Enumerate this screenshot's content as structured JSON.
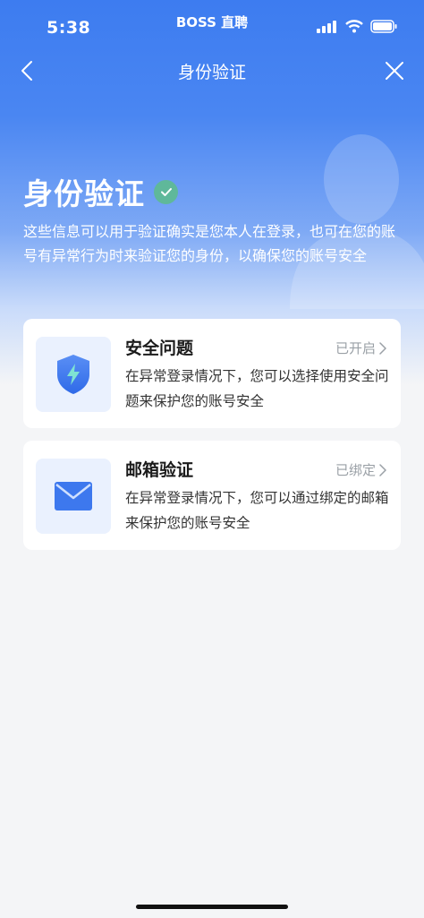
{
  "status_bar": {
    "time": "5:38",
    "carrier": "BOSS 直聘"
  },
  "nav": {
    "title": "身份验证",
    "back_icon": "chevron-left-icon",
    "close_icon": "close-icon"
  },
  "hero": {
    "title": "身份验证",
    "description": "这些信息可以用于验证确实是您本人在登录，也可在您的账号有异常行为时来验证您的身份，以确保您的账号安全"
  },
  "cards": [
    {
      "title": "安全问题",
      "status": "已开启",
      "body": "在异常登录情况下，您可以选择使用安全问题来保护您的账号安全",
      "icon": "shield-lightning-icon"
    },
    {
      "title": "邮箱验证",
      "status": "已绑定",
      "body": "在异常登录情况下，您可以通过绑定的邮箱来保护您的账号安全",
      "icon": "envelope-icon"
    }
  ],
  "colors": {
    "primary": "#3d7cf0",
    "badge": "#5fb89a",
    "card_icon_bg": "#eaf1fe"
  }
}
